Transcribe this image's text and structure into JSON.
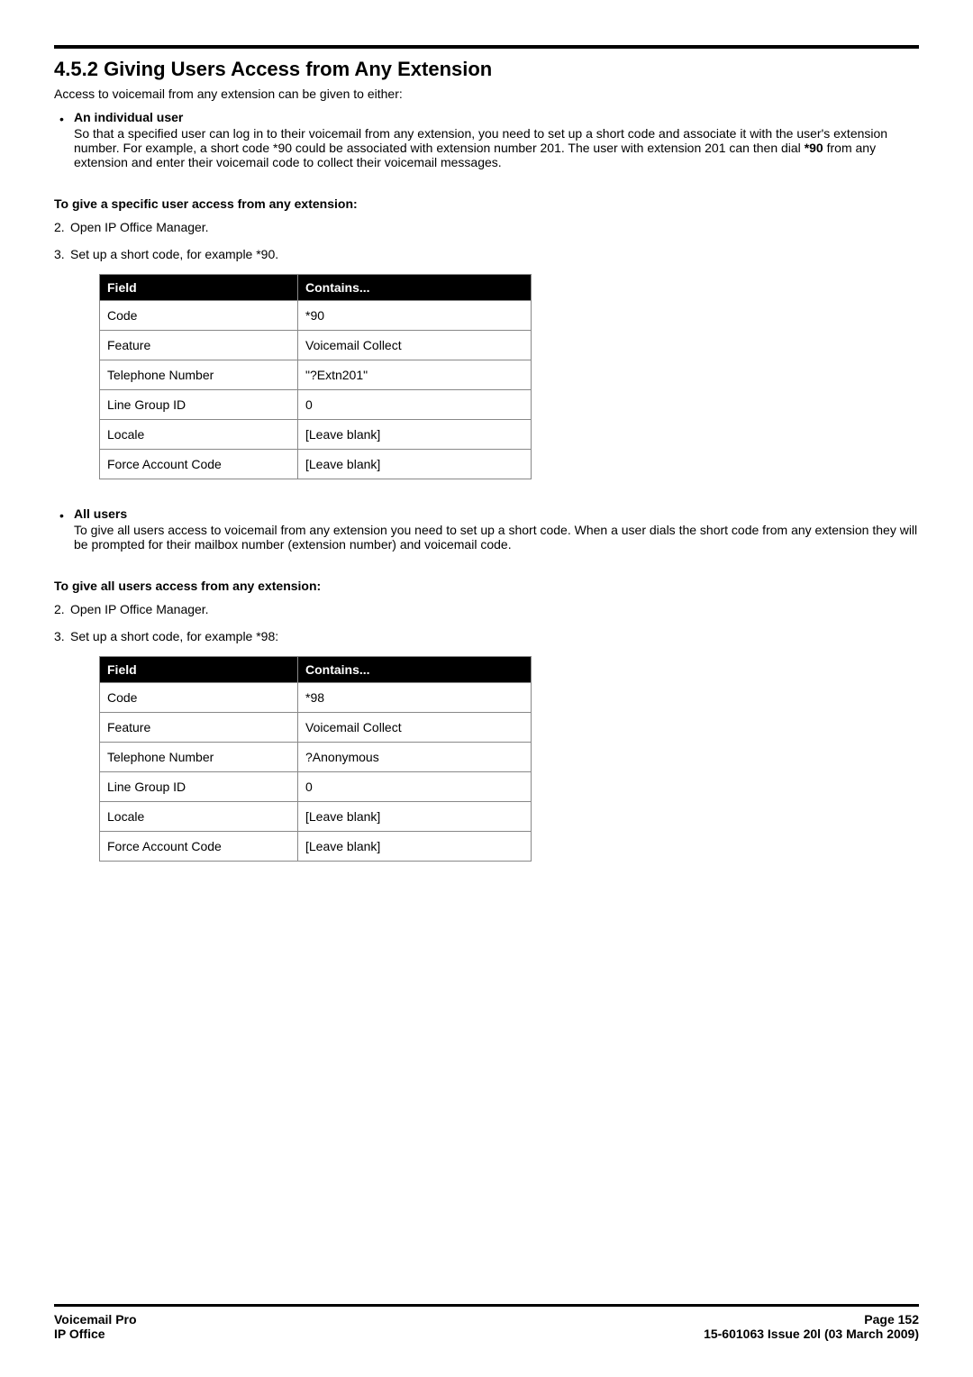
{
  "header": {
    "section_number": "4.5.2",
    "section_title": "Giving Users Access from Any Extension",
    "intro": "Access to voicemail from any extension can be given to either:"
  },
  "bullets": {
    "individual": {
      "title": "An individual user",
      "text_part1": "So that a specified user can log in to their voicemail from any extension, you need to set up a short code and associate it with the user's extension number. For example, a short code *90  could be associated with extension number 201. The user with extension 201 can then dial ",
      "text_bold": "*90",
      "text_part2": " from any extension and enter their voicemail code to collect their voicemail messages."
    },
    "all_users": {
      "title": "All users",
      "text": "To give all users access to voicemail from any extension you need to set up a short code. When a user dials the short code from any extension they will be prompted for their mailbox number (extension number) and voicemail code."
    }
  },
  "section1": {
    "subhead": "To give a specific user access from any extension:",
    "step2": "Open IP Office Manager.",
    "step3": "Set up a short code, for example *90.",
    "table": {
      "header_field": "Field",
      "header_contains": "Contains...",
      "rows": [
        {
          "field": "Code",
          "contains": "*90"
        },
        {
          "field": "Feature",
          "contains": "Voicemail Collect"
        },
        {
          "field": "Telephone Number",
          "contains": "\"?Extn201\""
        },
        {
          "field": "Line Group ID",
          "contains": "0"
        },
        {
          "field": "Locale",
          "contains": "[Leave blank]"
        },
        {
          "field": "Force Account Code",
          "contains": "[Leave blank]"
        }
      ]
    }
  },
  "section2": {
    "subhead": "To give all users access from any extension:",
    "step2": "Open IP Office Manager.",
    "step3": "Set up a short code, for example *98:",
    "table": {
      "header_field": "Field",
      "header_contains": "Contains...",
      "rows": [
        {
          "field": "Code",
          "contains": "*98"
        },
        {
          "field": "Feature",
          "contains": "Voicemail Collect"
        },
        {
          "field": "Telephone Number",
          "contains": "?Anonymous"
        },
        {
          "field": "Line Group ID",
          "contains": "0"
        },
        {
          "field": "Locale",
          "contains": "[Leave blank]"
        },
        {
          "field": "Force Account Code",
          "contains": "[Leave blank]"
        }
      ]
    }
  },
  "footer": {
    "left_line1": "Voicemail Pro",
    "left_line2": "IP Office",
    "right_line1": "Page 152",
    "right_line2": "15-601063 Issue 20l (03 March 2009)"
  }
}
